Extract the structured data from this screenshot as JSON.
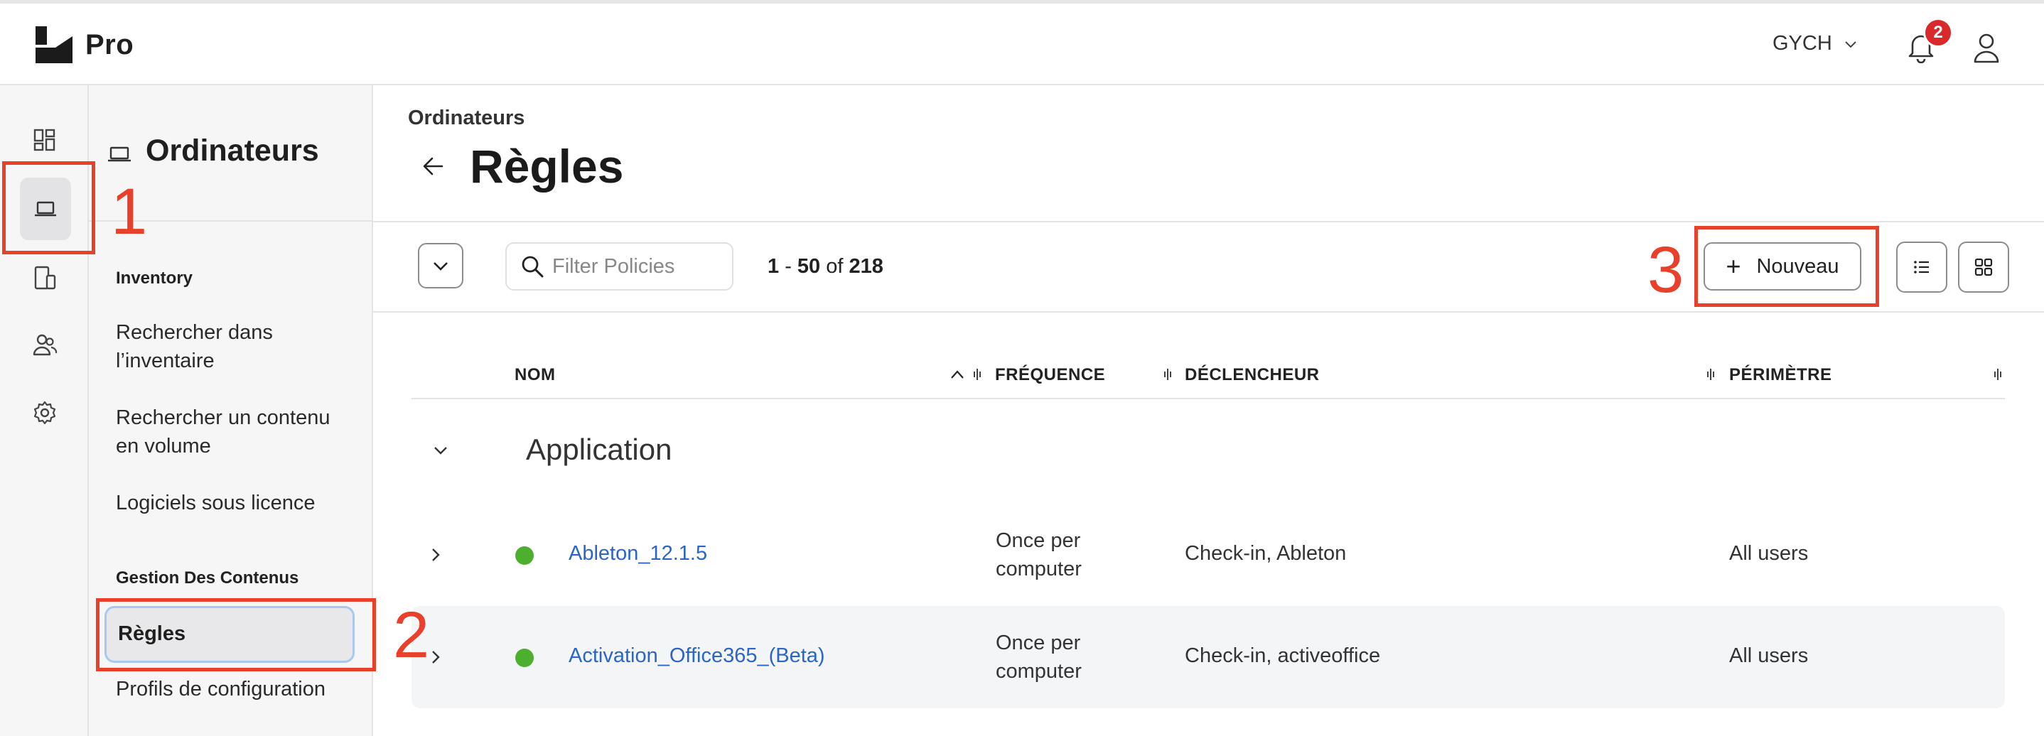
{
  "app": {
    "brand": "Pro"
  },
  "topbar": {
    "org": "GYCH",
    "notifications_count": "2"
  },
  "rail": {
    "items": [
      {
        "icon": "dashboard-icon"
      },
      {
        "icon": "laptop-icon",
        "active": true
      },
      {
        "icon": "mobile-devices-icon"
      },
      {
        "icon": "users-icon"
      },
      {
        "icon": "gear-icon"
      }
    ]
  },
  "sidebar": {
    "title": "Ordinateurs",
    "section_inventory": "Inventory",
    "inventory_links": [
      "Rechercher dans l’inventaire",
      "Rechercher un contenu en volume",
      "Logiciels sous licence"
    ],
    "section_content": "Gestion Des Contenus",
    "active_link": "Règles",
    "content_links": [
      "Profils de configuration"
    ]
  },
  "main": {
    "breadcrumb": "Ordinateurs",
    "title": "Règles",
    "filter_placeholder": "Filter Policies",
    "pager": {
      "from": "1",
      "to": "50",
      "of_label": "of",
      "total": "218"
    },
    "new_button": "Nouveau"
  },
  "table": {
    "columns": [
      "NOM",
      "FRÉQUENCE",
      "DÉCLENCHEUR",
      "PÉRIMÈTRE"
    ],
    "group": "Application",
    "rows": [
      {
        "name": "Ableton_12.1.5",
        "frequency": "Once per computer",
        "trigger": "Check-in, Ableton",
        "scope": "All users",
        "status": "enabled"
      },
      {
        "name": "Activation_Office365_(Beta)",
        "frequency": "Once per computer",
        "trigger": "Check-in, activeoffice",
        "scope": "All users",
        "status": "enabled"
      }
    ]
  },
  "annotations": [
    "1",
    "2",
    "3"
  ],
  "colors": {
    "accent_link": "#2a65c7",
    "status_green": "#4caf2e",
    "annotation_red": "#e8402a",
    "badge_red": "#d9292b"
  }
}
